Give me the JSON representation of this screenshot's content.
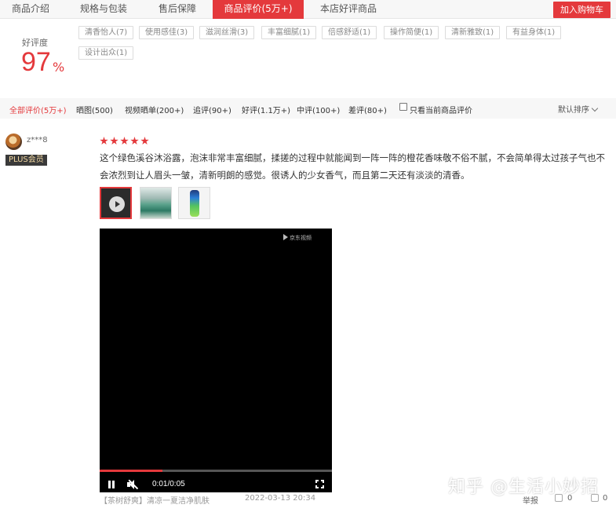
{
  "tabs": [
    {
      "label": "商品介绍",
      "active": false
    },
    {
      "label": "规格与包装",
      "active": false
    },
    {
      "label": "售后保障",
      "active": false
    },
    {
      "label": "商品评价(5万+)",
      "active": true
    },
    {
      "label": "本店好评商品",
      "active": false
    }
  ],
  "cart_button": "加入购物车",
  "rating": {
    "label": "好评度",
    "value": "97",
    "unit": "%"
  },
  "tags": [
    "清香怡人(7)",
    "使用感佳(3)",
    "滋润丝滑(3)",
    "丰富细腻(1)",
    "倍感舒适(1)",
    "操作简便(1)",
    "清新雅致(1)",
    "有益身体(1)",
    "设计出众(1)"
  ],
  "filters": [
    "全部评价(5万+)",
    "晒图(500)",
    "视频晒单(200+)",
    "追评(90+)",
    "好评(1.1万+)",
    "中评(100+)",
    "差评(80+)"
  ],
  "current_only_label": "只看当前商品评价",
  "sort_label": "默认排序",
  "review": {
    "username": "z***8",
    "badge": "PLUS会员",
    "stars": 5,
    "text": "这个绿色溪谷沐浴露，泡沫非常丰富细腻，揉搓的过程中就能闻到一阵一阵的橙花香味敬不俗不腻，不会简单得太过孩子气也不会浓烈到让人眉头一皱，清新明朗的感觉。很诱人的少女香气，而且第二天还有淡淡的清香。",
    "product": "【茶树舒爽】清凉一夏洁净肌肤",
    "date": "2022-03-13 20:34",
    "report": "举报",
    "likes": "0",
    "replies": "0"
  },
  "video": {
    "watermark": "京东视频",
    "time": "0:01/0:05",
    "progress": 0.27
  },
  "zhihu_watermark": "知乎 @生活小妙招",
  "colors": {
    "accent": "#e4393c"
  }
}
